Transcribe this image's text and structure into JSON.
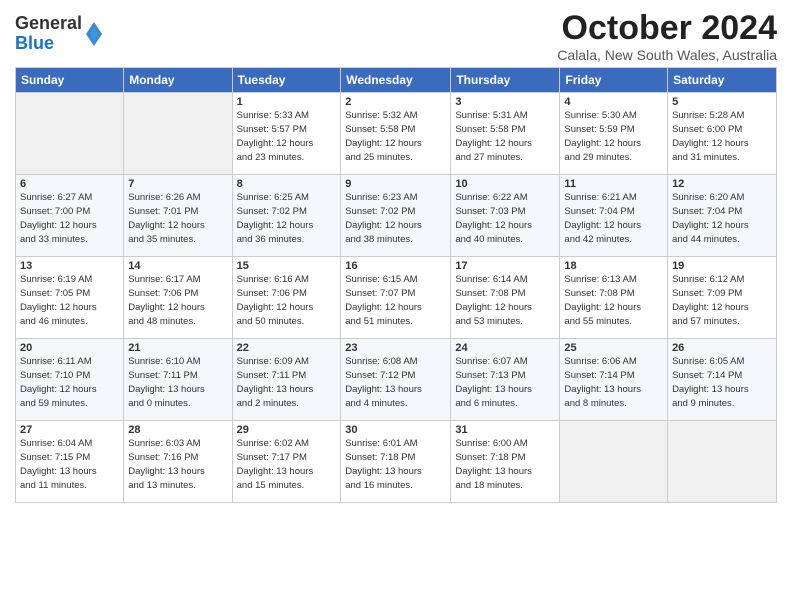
{
  "header": {
    "logo_general": "General",
    "logo_blue": "Blue",
    "month_title": "October 2024",
    "location": "Calala, New South Wales, Australia"
  },
  "columns": [
    "Sunday",
    "Monday",
    "Tuesday",
    "Wednesday",
    "Thursday",
    "Friday",
    "Saturday"
  ],
  "weeks": [
    [
      {
        "day": "",
        "detail": ""
      },
      {
        "day": "",
        "detail": ""
      },
      {
        "day": "1",
        "detail": "Sunrise: 5:33 AM\nSunset: 5:57 PM\nDaylight: 12 hours\nand 23 minutes."
      },
      {
        "day": "2",
        "detail": "Sunrise: 5:32 AM\nSunset: 5:58 PM\nDaylight: 12 hours\nand 25 minutes."
      },
      {
        "day": "3",
        "detail": "Sunrise: 5:31 AM\nSunset: 5:58 PM\nDaylight: 12 hours\nand 27 minutes."
      },
      {
        "day": "4",
        "detail": "Sunrise: 5:30 AM\nSunset: 5:59 PM\nDaylight: 12 hours\nand 29 minutes."
      },
      {
        "day": "5",
        "detail": "Sunrise: 5:28 AM\nSunset: 6:00 PM\nDaylight: 12 hours\nand 31 minutes."
      }
    ],
    [
      {
        "day": "6",
        "detail": "Sunrise: 6:27 AM\nSunset: 7:00 PM\nDaylight: 12 hours\nand 33 minutes."
      },
      {
        "day": "7",
        "detail": "Sunrise: 6:26 AM\nSunset: 7:01 PM\nDaylight: 12 hours\nand 35 minutes."
      },
      {
        "day": "8",
        "detail": "Sunrise: 6:25 AM\nSunset: 7:02 PM\nDaylight: 12 hours\nand 36 minutes."
      },
      {
        "day": "9",
        "detail": "Sunrise: 6:23 AM\nSunset: 7:02 PM\nDaylight: 12 hours\nand 38 minutes."
      },
      {
        "day": "10",
        "detail": "Sunrise: 6:22 AM\nSunset: 7:03 PM\nDaylight: 12 hours\nand 40 minutes."
      },
      {
        "day": "11",
        "detail": "Sunrise: 6:21 AM\nSunset: 7:04 PM\nDaylight: 12 hours\nand 42 minutes."
      },
      {
        "day": "12",
        "detail": "Sunrise: 6:20 AM\nSunset: 7:04 PM\nDaylight: 12 hours\nand 44 minutes."
      }
    ],
    [
      {
        "day": "13",
        "detail": "Sunrise: 6:19 AM\nSunset: 7:05 PM\nDaylight: 12 hours\nand 46 minutes."
      },
      {
        "day": "14",
        "detail": "Sunrise: 6:17 AM\nSunset: 7:06 PM\nDaylight: 12 hours\nand 48 minutes."
      },
      {
        "day": "15",
        "detail": "Sunrise: 6:16 AM\nSunset: 7:06 PM\nDaylight: 12 hours\nand 50 minutes."
      },
      {
        "day": "16",
        "detail": "Sunrise: 6:15 AM\nSunset: 7:07 PM\nDaylight: 12 hours\nand 51 minutes."
      },
      {
        "day": "17",
        "detail": "Sunrise: 6:14 AM\nSunset: 7:08 PM\nDaylight: 12 hours\nand 53 minutes."
      },
      {
        "day": "18",
        "detail": "Sunrise: 6:13 AM\nSunset: 7:08 PM\nDaylight: 12 hours\nand 55 minutes."
      },
      {
        "day": "19",
        "detail": "Sunrise: 6:12 AM\nSunset: 7:09 PM\nDaylight: 12 hours\nand 57 minutes."
      }
    ],
    [
      {
        "day": "20",
        "detail": "Sunrise: 6:11 AM\nSunset: 7:10 PM\nDaylight: 12 hours\nand 59 minutes."
      },
      {
        "day": "21",
        "detail": "Sunrise: 6:10 AM\nSunset: 7:11 PM\nDaylight: 13 hours\nand 0 minutes."
      },
      {
        "day": "22",
        "detail": "Sunrise: 6:09 AM\nSunset: 7:11 PM\nDaylight: 13 hours\nand 2 minutes."
      },
      {
        "day": "23",
        "detail": "Sunrise: 6:08 AM\nSunset: 7:12 PM\nDaylight: 13 hours\nand 4 minutes."
      },
      {
        "day": "24",
        "detail": "Sunrise: 6:07 AM\nSunset: 7:13 PM\nDaylight: 13 hours\nand 6 minutes."
      },
      {
        "day": "25",
        "detail": "Sunrise: 6:06 AM\nSunset: 7:14 PM\nDaylight: 13 hours\nand 8 minutes."
      },
      {
        "day": "26",
        "detail": "Sunrise: 6:05 AM\nSunset: 7:14 PM\nDaylight: 13 hours\nand 9 minutes."
      }
    ],
    [
      {
        "day": "27",
        "detail": "Sunrise: 6:04 AM\nSunset: 7:15 PM\nDaylight: 13 hours\nand 11 minutes."
      },
      {
        "day": "28",
        "detail": "Sunrise: 6:03 AM\nSunset: 7:16 PM\nDaylight: 13 hours\nand 13 minutes."
      },
      {
        "day": "29",
        "detail": "Sunrise: 6:02 AM\nSunset: 7:17 PM\nDaylight: 13 hours\nand 15 minutes."
      },
      {
        "day": "30",
        "detail": "Sunrise: 6:01 AM\nSunset: 7:18 PM\nDaylight: 13 hours\nand 16 minutes."
      },
      {
        "day": "31",
        "detail": "Sunrise: 6:00 AM\nSunset: 7:18 PM\nDaylight: 13 hours\nand 18 minutes."
      },
      {
        "day": "",
        "detail": ""
      },
      {
        "day": "",
        "detail": ""
      }
    ]
  ]
}
